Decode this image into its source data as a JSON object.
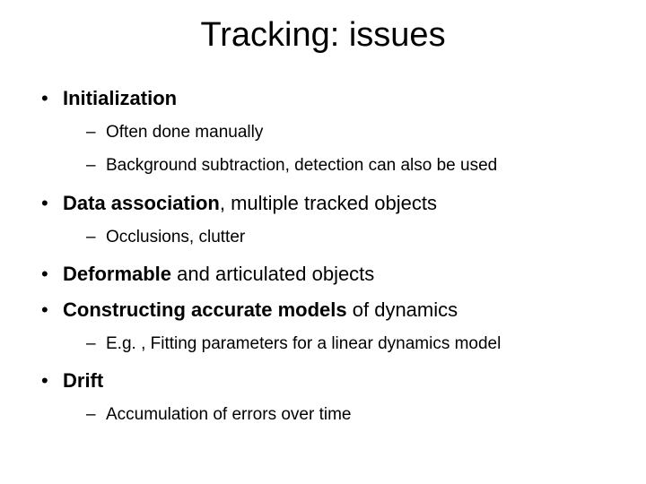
{
  "title": "Tracking: issues",
  "bullets": {
    "b0": {
      "bold": "Initialization",
      "rest": ""
    },
    "b0s0": "Often done manually",
    "b0s1": "Background subtraction, detection can also be used",
    "b1": {
      "bold": "Data association",
      "rest": ", multiple tracked objects"
    },
    "b1s0": "Occlusions, clutter",
    "b2": {
      "bold": "Deformable",
      "rest": " and articulated objects"
    },
    "b3": {
      "bold": "Constructing accurate models",
      "rest": " of dynamics"
    },
    "b3s0": "E.g. , Fitting parameters for a linear dynamics model",
    "b4": {
      "bold": "Drift",
      "rest": ""
    },
    "b4s0": "Accumulation of errors over time"
  }
}
